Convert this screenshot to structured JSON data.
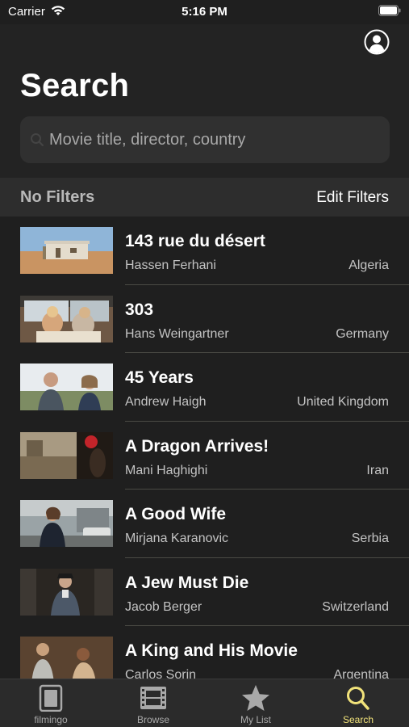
{
  "status_bar": {
    "carrier": "Carrier",
    "time": "5:16 PM"
  },
  "header": {
    "title": "Search"
  },
  "search": {
    "placeholder": "Movie title, director, country",
    "value": ""
  },
  "filters": {
    "status_label": "No Filters",
    "edit_label": "Edit Filters"
  },
  "movies": [
    {
      "title": "143 rue du désert",
      "director": "Hassen Ferhani",
      "country": "Algeria"
    },
    {
      "title": "303",
      "director": "Hans Weingartner",
      "country": "Germany"
    },
    {
      "title": "45 Years",
      "director": "Andrew Haigh",
      "country": "United Kingdom"
    },
    {
      "title": "A Dragon Arrives!",
      "director": "Mani Haghighi",
      "country": "Iran"
    },
    {
      "title": "A Good Wife",
      "director": "Mirjana Karanovic",
      "country": "Serbia"
    },
    {
      "title": "A Jew Must Die",
      "director": "Jacob Berger",
      "country": "Switzerland"
    },
    {
      "title": "A King and His Movie",
      "director": "Carlos Sorin",
      "country": "Argentina"
    }
  ],
  "tabs": [
    {
      "label": "filmingo",
      "icon": "phone-book-icon",
      "active": false
    },
    {
      "label": "Browse",
      "icon": "film-strip-icon",
      "active": false
    },
    {
      "label": "My List",
      "icon": "star-icon",
      "active": false
    },
    {
      "label": "Search",
      "icon": "magnifier-icon",
      "active": true
    }
  ],
  "colors": {
    "background": "#1f1f1f",
    "accent": "#f1e27a",
    "inactive_tab": "#a9a9a9"
  }
}
